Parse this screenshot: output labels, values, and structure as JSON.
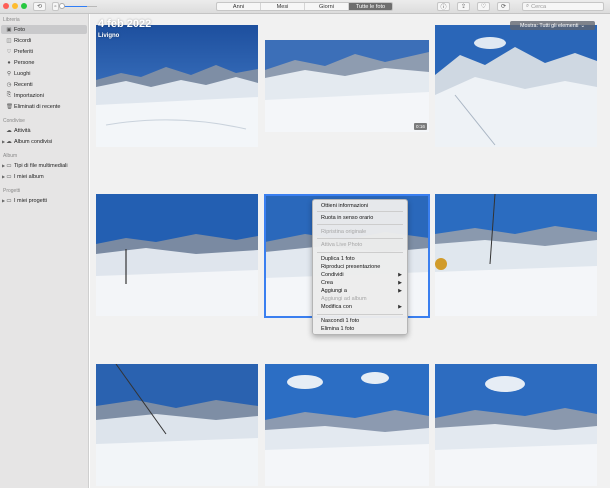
{
  "toolbar": {
    "tabs": [
      "Anni",
      "Mesi",
      "Giorni",
      "Tutte le foto"
    ],
    "active_tab": "Tutte le foto",
    "search_placeholder": "Cerca"
  },
  "sidebar": {
    "sections": {
      "libreria": "Libreria",
      "condivise": "Condivise",
      "album": "Album",
      "progetti": "Progetti"
    },
    "libreria_items": [
      {
        "label": "Foto",
        "icon": "photos-icon"
      },
      {
        "label": "Ricordi",
        "icon": "memories-icon"
      },
      {
        "label": "Preferiti",
        "icon": "heart-icon"
      },
      {
        "label": "Persone",
        "icon": "person-icon"
      },
      {
        "label": "Luoghi",
        "icon": "pin-icon"
      },
      {
        "label": "Recenti",
        "icon": "clock-icon"
      },
      {
        "label": "Importazioni",
        "icon": "import-icon"
      },
      {
        "label": "Eliminati di recente",
        "icon": "trash-icon"
      }
    ],
    "condivise_items": [
      {
        "label": "Attività",
        "icon": "cloud-icon"
      },
      {
        "label": "Album condivisi",
        "icon": "shared-album-icon"
      }
    ],
    "album_items": [
      {
        "label": "Tipi di file multimediali",
        "icon": "folder-icon"
      },
      {
        "label": "I miei album",
        "icon": "folder-icon"
      }
    ],
    "progetti_items": [
      {
        "label": "I miei progetti",
        "icon": "folder-icon"
      }
    ]
  },
  "main": {
    "date_title": "4 feb 2022",
    "location": "Livigno",
    "filter_label": "Mostra: Tutti gli elementi",
    "video_duration": "0:16"
  },
  "context_menu": {
    "items": [
      {
        "label": "Ottieni informazioni",
        "enabled": true,
        "submenu": false
      },
      {
        "label": "Ruota in senso orario",
        "enabled": true,
        "submenu": false
      },
      {
        "label": "Ripristina originale",
        "enabled": false,
        "submenu": false
      },
      {
        "label": "Attiva Live Photo",
        "enabled": false,
        "submenu": false
      },
      {
        "label": "Duplica 1 foto",
        "enabled": true,
        "submenu": false
      },
      {
        "label": "Riproduci presentazione",
        "enabled": true,
        "submenu": false
      },
      {
        "label": "Condividi",
        "enabled": true,
        "submenu": true
      },
      {
        "label": "Crea",
        "enabled": true,
        "submenu": true
      },
      {
        "label": "Aggiungi a",
        "enabled": true,
        "submenu": true
      },
      {
        "label": "Aggiungi ad album",
        "enabled": false,
        "submenu": false
      },
      {
        "label": "Modifica con",
        "enabled": true,
        "submenu": true
      },
      {
        "label": "Nascondi 1 foto",
        "enabled": true,
        "submenu": false
      },
      {
        "label": "Elimina 1 foto",
        "enabled": true,
        "submenu": false
      }
    ]
  },
  "colors": {
    "accent": "#3a7ff0",
    "sky": "#2f6fc4",
    "snow": "#f2f5f8",
    "mountain": "#5b6b80"
  }
}
